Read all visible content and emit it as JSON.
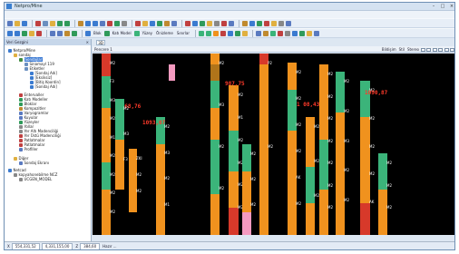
{
  "window": {
    "title": "Netpro/Mine",
    "controls": [
      "–",
      "□",
      "×"
    ]
  },
  "menu": [
    "Dosya",
    "Görünüm",
    "Pencere",
    "Düzenle",
    "Çiz",
    "Sorgu",
    "Katı Model",
    "Blokiama",
    "Jeoistatistik",
    "Araçlar",
    "Yardım"
  ],
  "toolbar2": {
    "blok_label": "Blok",
    "kati_model_label": "Katı Model",
    "yuzey_label": "Yüzey",
    "onizleme_label": "Önizleme",
    "sinirlar_label": "Sınırlar"
  },
  "left_panel": {
    "title": "Veri Gezgini",
    "tree": [
      {
        "label": "Netpro/Mine",
        "depth": 0,
        "icon": "globe-icon",
        "color": "#3b7bd0"
      },
      {
        "label": "sondaj",
        "depth": 1,
        "icon": "folder-icon",
        "color": "#e0b040"
      },
      {
        "label": "Sondajlar",
        "depth": 2,
        "icon": "drill-icon",
        "color": "#3f8a3f",
        "selected": true
      },
      {
        "label": "Sinamayl 119",
        "depth": 3,
        "icon": "table-icon",
        "color": "#6a8fc0"
      },
      {
        "label": "Etiketler",
        "depth": 3,
        "icon": "tag-icon",
        "color": "#6a8fc0"
      },
      {
        "label": "[Sondaj Adı]",
        "depth": 4,
        "icon": "check-icon",
        "color": "#3b7bd0"
      },
      {
        "label": "[Eksiksiz]",
        "depth": 4,
        "icon": "check-icon",
        "color": "#3b7bd0"
      },
      {
        "label": "[Bitiş Koordin]",
        "depth": 4,
        "icon": "check-icon",
        "color": "#3b7bd0"
      },
      {
        "label": "[Sondaj Adı]",
        "depth": 4,
        "icon": "check-icon",
        "color": "#3b7bd0"
      },
      {
        "label": "Entervaller",
        "depth": 2,
        "icon": "interval-icon",
        "color": "#c04040"
      },
      {
        "label": "Katı Modeller",
        "depth": 2,
        "icon": "solid-icon",
        "color": "#2f9a5a"
      },
      {
        "label": "Bloklar",
        "depth": 2,
        "icon": "block-icon",
        "color": "#2f9a5a"
      },
      {
        "label": "Kompozitler",
        "depth": 2,
        "icon": "composite-icon",
        "color": "#c08a30"
      },
      {
        "label": "Varyogramlar",
        "depth": 2,
        "icon": "variogram-icon",
        "color": "#5a7ac0"
      },
      {
        "label": "Kuyular",
        "depth": 2,
        "icon": "well-icon",
        "color": "#5a7ac0"
      },
      {
        "label": "Yüzeyler",
        "depth": 2,
        "icon": "surface-icon",
        "color": "#2f9a5a"
      },
      {
        "label": "Yollar",
        "depth": 2,
        "icon": "road-icon",
        "color": "#888888"
      },
      {
        "label": "Yer Altı Madenciliği",
        "depth": 2,
        "icon": "mine-icon",
        "color": "#888888"
      },
      {
        "label": "Yer Üstü Madenciliği",
        "depth": 2,
        "icon": "pit-icon",
        "color": "#c04040"
      },
      {
        "label": "Patlatmalar",
        "depth": 2,
        "icon": "blast-icon",
        "color": "#c04040"
      },
      {
        "label": "Patlatmalar",
        "depth": 2,
        "icon": "blast-icon",
        "color": "#c04040"
      },
      {
        "label": "Profiller",
        "depth": 2,
        "icon": "profile-icon",
        "color": "#5a7ac0"
      },
      {
        "label": "Diğer",
        "depth": 1,
        "icon": "folder-icon",
        "color": "#e0b040"
      },
      {
        "label": "Sondaj Ekranı",
        "depth": 2,
        "icon": "screen-icon",
        "color": "#5a7ac0"
      },
      {
        "label": "Netcad",
        "depth": 0,
        "icon": "netcad-icon",
        "color": "#3b7bd0"
      },
      {
        "label": "kopyahonebilme NCZ",
        "depth": 1,
        "icon": "file-icon",
        "color": "#888888"
      },
      {
        "label": "UCGEN_MODEL",
        "depth": 2,
        "icon": "model-icon",
        "color": "#888888"
      }
    ]
  },
  "doc_tab": "3D",
  "view": {
    "title": "Pencere 1",
    "options": [
      "Bildişim",
      "Stil",
      "Stereo"
    ]
  },
  "canvas": {
    "background": "#000000",
    "colors": {
      "orange": "#f0921e",
      "green": "#3bb47a",
      "red": "#d7392a",
      "pink": "#f49ac0",
      "brown": "#b0741a",
      "tag": "#ff3a2a"
    },
    "drillholes": [
      {
        "name": "hole-1",
        "tag": "1168,76",
        "labels": [
          "M2",
          "F3",
          "M3",
          "M2",
          "M1",
          "M2",
          "M2",
          "M2",
          "M2"
        ]
      },
      {
        "name": "hole-2",
        "tag": "",
        "labels": [
          "M2",
          "M3",
          "F3"
        ]
      },
      {
        "name": "hole-3",
        "tag": "",
        "labels": [
          "ZKI",
          "M2",
          "M2"
        ]
      },
      {
        "name": "hole-4",
        "tag": "1093,07",
        "labels": [
          "M2",
          "M3",
          "M2",
          "M1"
        ]
      },
      {
        "name": "hole-5",
        "tag": "",
        "labels": []
      },
      {
        "name": "hole-6",
        "tag": "",
        "labels": [
          "M2",
          "M3",
          "M2",
          "M2"
        ]
      },
      {
        "name": "hole-7",
        "tag": "987,75",
        "labels": [
          "M2",
          "M1",
          "M2",
          "M2",
          "M2",
          "M2"
        ]
      },
      {
        "name": "hole-8",
        "tag": "",
        "labels": [
          "M2",
          "M2",
          "M2"
        ]
      },
      {
        "name": "hole-9",
        "tag": "",
        "labels": [
          "P2",
          "M2"
        ]
      },
      {
        "name": "hole-10",
        "tag": "1 08,43",
        "labels": [
          "M2",
          "M2",
          "M2",
          "M2",
          "AK",
          "M2"
        ]
      },
      {
        "name": "hole-11",
        "tag": "",
        "labels": [
          "M2",
          "M2",
          "M2"
        ]
      },
      {
        "name": "hole-12",
        "tag": "",
        "labels": [
          "M2",
          "M2",
          "M2",
          "M2",
          "M2",
          "M2",
          "M2"
        ]
      },
      {
        "name": "hole-13",
        "tag": "",
        "labels": [
          "M2",
          "M2",
          "M3",
          "M2",
          "M2"
        ]
      },
      {
        "name": "hole-14",
        "tag": "1090,87",
        "labels": [
          "M2",
          "M2",
          "M2",
          "M2",
          "AK"
        ]
      },
      {
        "name": "hole-15",
        "tag": "",
        "labels": [
          "M2",
          "M2",
          "M2"
        ]
      }
    ]
  },
  "status": {
    "x_label": "X",
    "x_value": "554,331,52",
    "y_value": "4,331,155,00",
    "z_label": "Z",
    "z_value": "384,60",
    "state": "Hazır ..."
  }
}
